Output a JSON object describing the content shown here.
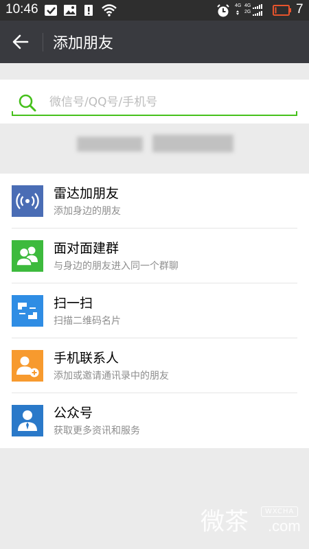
{
  "status_bar": {
    "time": "10:46",
    "network": "4G",
    "network_2": "4G",
    "network_3": "2G",
    "battery": "7"
  },
  "header": {
    "title": "添加朋友"
  },
  "search": {
    "placeholder": "微信号/QQ号/手机号"
  },
  "list": [
    {
      "title": "雷达加朋友",
      "subtitle": "添加身边的朋友",
      "icon": "radar-icon",
      "color": "#4a6db5"
    },
    {
      "title": "面对面建群",
      "subtitle": "与身边的朋友进入同一个群聊",
      "icon": "face-to-face-group-icon",
      "color": "#3dba3d"
    },
    {
      "title": "扫一扫",
      "subtitle": "扫描二维码名片",
      "icon": "scan-icon",
      "color": "#2f8de4"
    },
    {
      "title": "手机联系人",
      "subtitle": "添加或邀请通讯录中的朋友",
      "icon": "phone-contacts-icon",
      "color": "#f79a2e"
    },
    {
      "title": "公众号",
      "subtitle": "获取更多资讯和服务",
      "icon": "official-account-icon",
      "color": "#2a79c9"
    }
  ],
  "watermark": {
    "main": "微茶",
    "site": "WXCHA",
    "domain": ".com"
  }
}
